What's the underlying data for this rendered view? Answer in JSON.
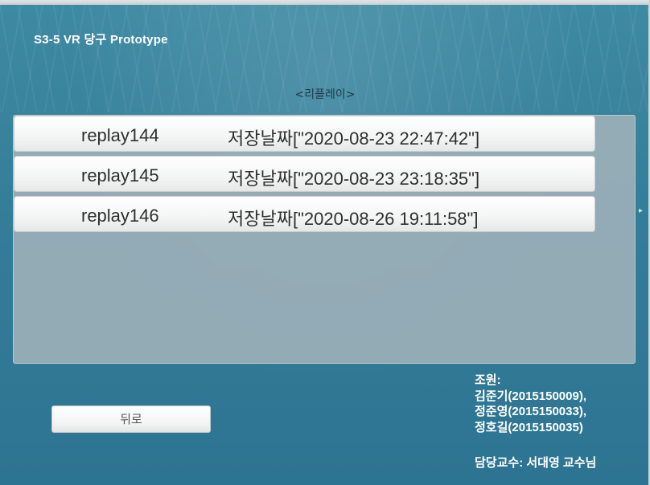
{
  "app": {
    "title": "S3-5 VR 당구 Prototype"
  },
  "replay_section": {
    "title": "<리플레이>",
    "items": [
      {
        "name": "replay144",
        "date": "저장날짜[\"2020-08-23 22:47:42\"]"
      },
      {
        "name": "replay145",
        "date": "저장날짜[\"2020-08-23 23:18:35\"]"
      },
      {
        "name": "replay146",
        "date": "저장날짜[\"2020-08-26 19:11:58\"]"
      }
    ]
  },
  "footer": {
    "back_label": "뒤로",
    "members_heading": "조원:",
    "members": [
      "김준기(2015150009),",
      "정준영(2015150033),",
      "정호길(2015150035)"
    ],
    "professor": "담당교수: 서대영 교수님"
  },
  "colors": {
    "background": "#347d98",
    "panel": "#a0b2ba",
    "text_dark": "#2f2f2f",
    "text_light": "#ffffff"
  }
}
